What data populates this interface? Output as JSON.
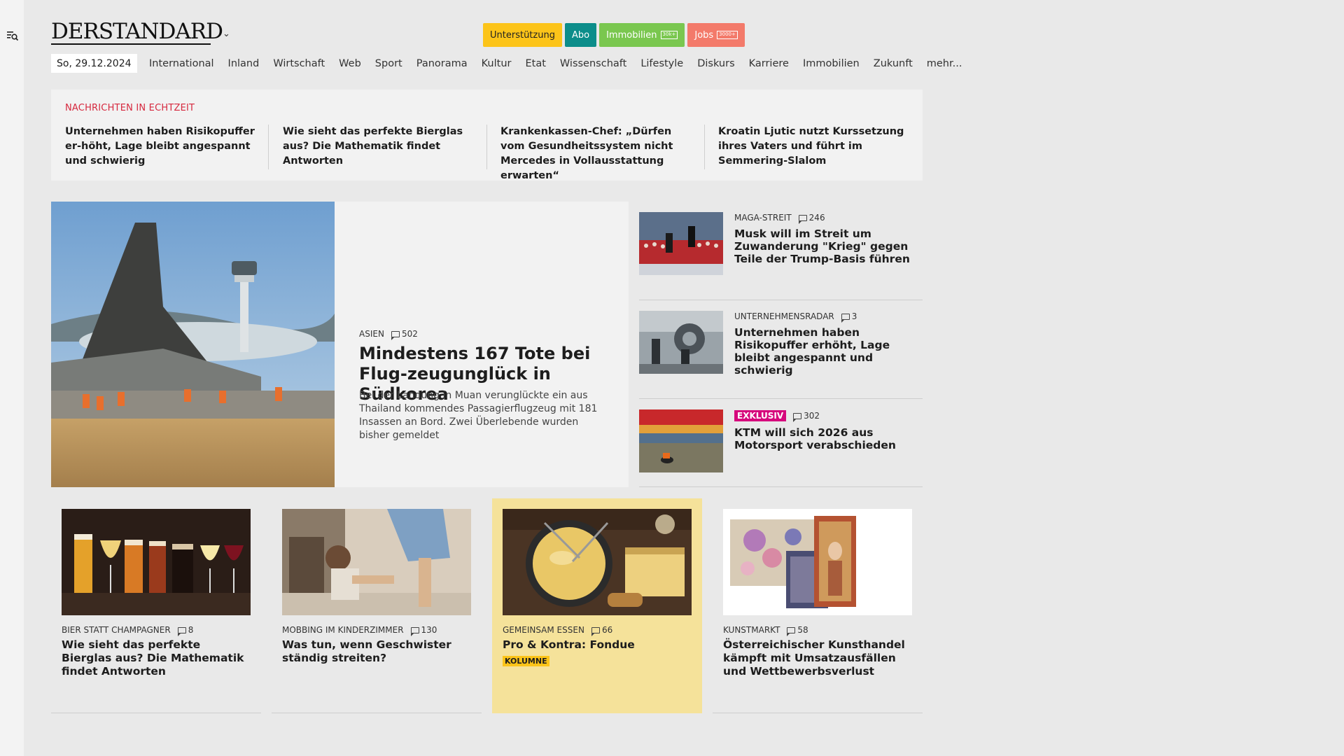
{
  "header": {
    "logo": "DERSTANDARD",
    "pills": {
      "support": "Unterstützung",
      "abo": "Abo",
      "immo": "Immobilien",
      "immo_count": "30k+",
      "jobs": "Jobs",
      "jobs_count": "3000+"
    },
    "date": "So, 29.12.2024",
    "nav": [
      "International",
      "Inland",
      "Wirtschaft",
      "Web",
      "Sport",
      "Panorama",
      "Kultur",
      "Etat",
      "Wissenschaft",
      "Lifestyle",
      "Diskurs",
      "Karriere",
      "Immobilien",
      "Zukunft",
      "mehr..."
    ]
  },
  "ticker": {
    "title": "NACHRICHTEN IN ECHTZEIT",
    "items": [
      "Unternehmen haben Risikopuffer er-höht, Lage bleibt angespannt und schwierig",
      "Wie sieht das perfekte Bierglas aus? Die Mathematik findet Antworten",
      "Krankenkassen-Chef: „Dürfen vom Gesundheitssystem nicht Mercedes in Vollausstattung erwarten“",
      "Kroatin Ljutic nutzt Kurssetzung ihres Vaters und führt im Semmering-Slalom"
    ]
  },
  "hero": {
    "kicker": "ASIEN",
    "comments": "502",
    "title": "Mindestens 167 Tote bei Flug-zeugunglück in Südkorea",
    "lead": "Bei der Landung in Muan verunglückte ein aus Thailand kommendes Passagierflugzeug mit 181 Insassen an Bord. Zwei Überlebende wurden bisher gemeldet"
  },
  "side": [
    {
      "kicker": "MAGA-STREIT",
      "comments": "246",
      "title": "Musk will im Streit um Zuwanderung \"Krieg\" gegen Teile der Trump-Basis führen"
    },
    {
      "kicker": "UNTERNEHMENSRADAR",
      "comments": "3",
      "title": "Unternehmen haben Risikopuffer erhöht, Lage bleibt angespannt und schwierig"
    },
    {
      "badge": "EXKLUSIV",
      "comments": "302",
      "title": "KTM will sich 2026 aus Motorsport verabschieden"
    }
  ],
  "cards": [
    {
      "kicker": "BIER STATT CHAMPAGNER",
      "comments": "8",
      "title": "Wie sieht das perfekte Bierglas aus? Die Mathematik findet Antworten"
    },
    {
      "kicker": "MOBBING IM KINDERZIMMER",
      "comments": "130",
      "title": "Was tun, wenn Geschwister ständig streiten?"
    },
    {
      "kicker": "GEMEINSAM ESSEN",
      "comments": "66",
      "title": "Pro & Kontra: Fondue",
      "label": "KOLUMNE"
    },
    {
      "kicker": "KUNSTMARKT",
      "comments": "58",
      "title": "Österreichischer Kunsthandel kämpft mit Umsatzausfällen und Wettbewerbsverlust"
    }
  ]
}
